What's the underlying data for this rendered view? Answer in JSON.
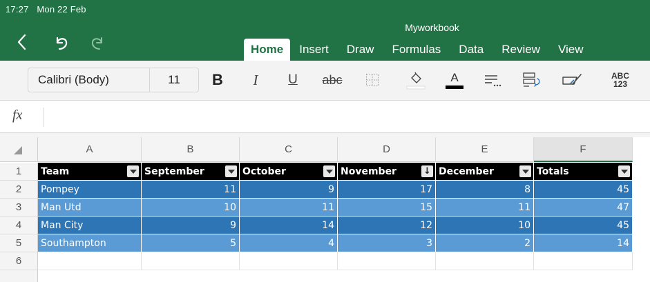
{
  "status_bar": {
    "time": "17:27",
    "date": "Mon 22 Feb"
  },
  "workbook_title": "Myworkbook",
  "nav": {
    "back_icon": "chevron-left-icon",
    "undo_icon": "undo-icon",
    "redo_icon": "redo-icon"
  },
  "tabs": [
    {
      "label": "Home",
      "active": true
    },
    {
      "label": "Insert",
      "active": false
    },
    {
      "label": "Draw",
      "active": false
    },
    {
      "label": "Formulas",
      "active": false
    },
    {
      "label": "Data",
      "active": false
    },
    {
      "label": "Review",
      "active": false
    },
    {
      "label": "View",
      "active": false
    }
  ],
  "ribbon": {
    "font_name": "Calibri (Body)",
    "font_size": "11",
    "bold": "B",
    "italic": "I",
    "underline": "U",
    "strikethrough": "abc",
    "number_format_top": "ABC",
    "number_format_bottom": "123"
  },
  "formula_bar": {
    "fx_label": "fx",
    "value": ""
  },
  "grid": {
    "columns": [
      "A",
      "B",
      "C",
      "D",
      "E",
      "F"
    ],
    "selected_column": "F",
    "rows": [
      "1",
      "2",
      "3",
      "4",
      "5",
      "6"
    ]
  },
  "table": {
    "headers": [
      "Team",
      "September",
      "October",
      "November",
      "December",
      "Totals"
    ],
    "sorted_column": "November",
    "rows": [
      [
        "Pompey",
        "11",
        "9",
        "17",
        "8",
        "45"
      ],
      [
        "Man Utd",
        "10",
        "11",
        "15",
        "11",
        "47"
      ],
      [
        "Man City",
        "9",
        "14",
        "12",
        "10",
        "45"
      ],
      [
        "Southampton",
        "5",
        "4",
        "3",
        "2",
        "14"
      ]
    ]
  },
  "colors": {
    "app_green": "#217346",
    "header_black": "#000000",
    "band_dark": "#2e75b6",
    "band_light": "#5b9bd5"
  }
}
